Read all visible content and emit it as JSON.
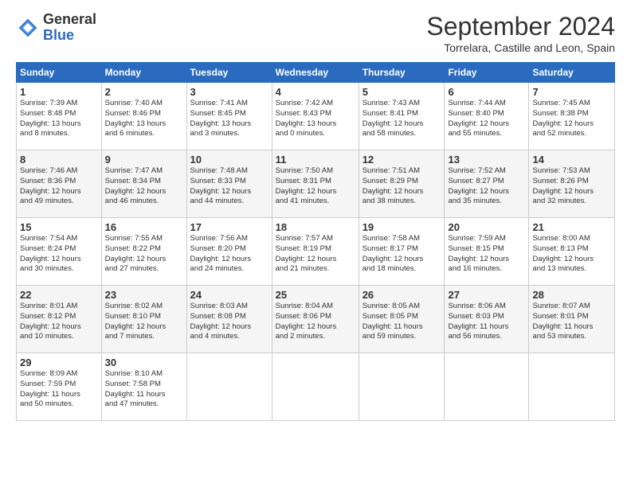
{
  "logo": {
    "general": "General",
    "blue": "Blue"
  },
  "header": {
    "month": "September 2024",
    "location": "Torrelara, Castille and Leon, Spain"
  },
  "weekdays": [
    "Sunday",
    "Monday",
    "Tuesday",
    "Wednesday",
    "Thursday",
    "Friday",
    "Saturday"
  ],
  "weeks": [
    [
      {
        "day": "1",
        "info": "Sunrise: 7:39 AM\nSunset: 8:48 PM\nDaylight: 13 hours\nand 8 minutes."
      },
      {
        "day": "2",
        "info": "Sunrise: 7:40 AM\nSunset: 8:46 PM\nDaylight: 13 hours\nand 6 minutes."
      },
      {
        "day": "3",
        "info": "Sunrise: 7:41 AM\nSunset: 8:45 PM\nDaylight: 13 hours\nand 3 minutes."
      },
      {
        "day": "4",
        "info": "Sunrise: 7:42 AM\nSunset: 8:43 PM\nDaylight: 13 hours\nand 0 minutes."
      },
      {
        "day": "5",
        "info": "Sunrise: 7:43 AM\nSunset: 8:41 PM\nDaylight: 12 hours\nand 58 minutes."
      },
      {
        "day": "6",
        "info": "Sunrise: 7:44 AM\nSunset: 8:40 PM\nDaylight: 12 hours\nand 55 minutes."
      },
      {
        "day": "7",
        "info": "Sunrise: 7:45 AM\nSunset: 8:38 PM\nDaylight: 12 hours\nand 52 minutes."
      }
    ],
    [
      {
        "day": "8",
        "info": "Sunrise: 7:46 AM\nSunset: 8:36 PM\nDaylight: 12 hours\nand 49 minutes."
      },
      {
        "day": "9",
        "info": "Sunrise: 7:47 AM\nSunset: 8:34 PM\nDaylight: 12 hours\nand 46 minutes."
      },
      {
        "day": "10",
        "info": "Sunrise: 7:48 AM\nSunset: 8:33 PM\nDaylight: 12 hours\nand 44 minutes."
      },
      {
        "day": "11",
        "info": "Sunrise: 7:50 AM\nSunset: 8:31 PM\nDaylight: 12 hours\nand 41 minutes."
      },
      {
        "day": "12",
        "info": "Sunrise: 7:51 AM\nSunset: 8:29 PM\nDaylight: 12 hours\nand 38 minutes."
      },
      {
        "day": "13",
        "info": "Sunrise: 7:52 AM\nSunset: 8:27 PM\nDaylight: 12 hours\nand 35 minutes."
      },
      {
        "day": "14",
        "info": "Sunrise: 7:53 AM\nSunset: 8:26 PM\nDaylight: 12 hours\nand 32 minutes."
      }
    ],
    [
      {
        "day": "15",
        "info": "Sunrise: 7:54 AM\nSunset: 8:24 PM\nDaylight: 12 hours\nand 30 minutes."
      },
      {
        "day": "16",
        "info": "Sunrise: 7:55 AM\nSunset: 8:22 PM\nDaylight: 12 hours\nand 27 minutes."
      },
      {
        "day": "17",
        "info": "Sunrise: 7:56 AM\nSunset: 8:20 PM\nDaylight: 12 hours\nand 24 minutes."
      },
      {
        "day": "18",
        "info": "Sunrise: 7:57 AM\nSunset: 8:19 PM\nDaylight: 12 hours\nand 21 minutes."
      },
      {
        "day": "19",
        "info": "Sunrise: 7:58 AM\nSunset: 8:17 PM\nDaylight: 12 hours\nand 18 minutes."
      },
      {
        "day": "20",
        "info": "Sunrise: 7:59 AM\nSunset: 8:15 PM\nDaylight: 12 hours\nand 16 minutes."
      },
      {
        "day": "21",
        "info": "Sunrise: 8:00 AM\nSunset: 8:13 PM\nDaylight: 12 hours\nand 13 minutes."
      }
    ],
    [
      {
        "day": "22",
        "info": "Sunrise: 8:01 AM\nSunset: 8:12 PM\nDaylight: 12 hours\nand 10 minutes."
      },
      {
        "day": "23",
        "info": "Sunrise: 8:02 AM\nSunset: 8:10 PM\nDaylight: 12 hours\nand 7 minutes."
      },
      {
        "day": "24",
        "info": "Sunrise: 8:03 AM\nSunset: 8:08 PM\nDaylight: 12 hours\nand 4 minutes."
      },
      {
        "day": "25",
        "info": "Sunrise: 8:04 AM\nSunset: 8:06 PM\nDaylight: 12 hours\nand 2 minutes."
      },
      {
        "day": "26",
        "info": "Sunrise: 8:05 AM\nSunset: 8:05 PM\nDaylight: 11 hours\nand 59 minutes."
      },
      {
        "day": "27",
        "info": "Sunrise: 8:06 AM\nSunset: 8:03 PM\nDaylight: 11 hours\nand 56 minutes."
      },
      {
        "day": "28",
        "info": "Sunrise: 8:07 AM\nSunset: 8:01 PM\nDaylight: 11 hours\nand 53 minutes."
      }
    ],
    [
      {
        "day": "29",
        "info": "Sunrise: 8:09 AM\nSunset: 7:59 PM\nDaylight: 11 hours\nand 50 minutes."
      },
      {
        "day": "30",
        "info": "Sunrise: 8:10 AM\nSunset: 7:58 PM\nDaylight: 11 hours\nand 47 minutes."
      },
      null,
      null,
      null,
      null,
      null
    ]
  ]
}
